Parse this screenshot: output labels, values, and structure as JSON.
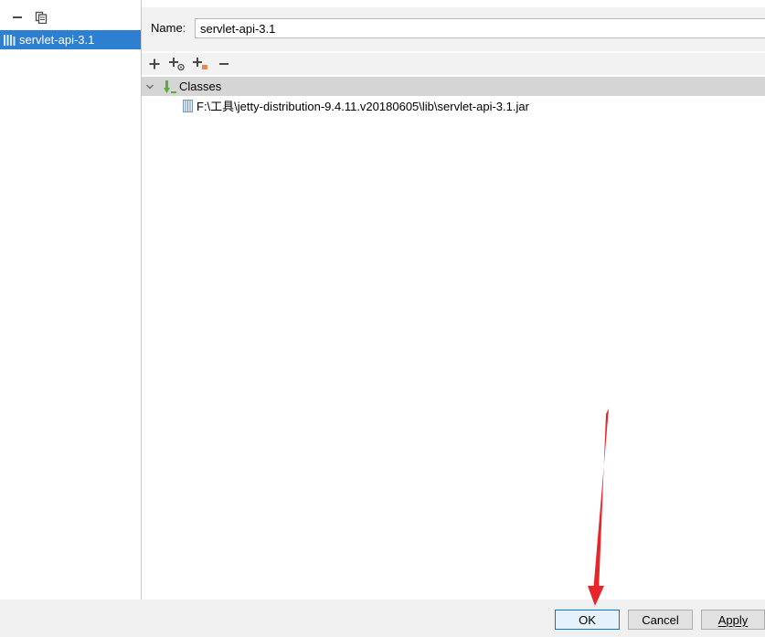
{
  "libraries": {
    "items": [
      {
        "label": "servlet-api-3.1",
        "selected": true
      }
    ]
  },
  "library_editor": {
    "name_label": "Name:",
    "name_value": "servlet-api-3.1",
    "tree": {
      "root_label": "Classes",
      "children": [
        {
          "path": "F:\\工具\\jetty-distribution-9.4.11.v20180605\\lib\\servlet-api-3.1.jar"
        }
      ]
    }
  },
  "buttons": {
    "ok": "OK",
    "cancel": "Cancel",
    "apply": "Apply"
  },
  "colors": {
    "selection": "#2d7fd2",
    "arrow": "#e8262a",
    "focus_border": "#0078d7"
  }
}
